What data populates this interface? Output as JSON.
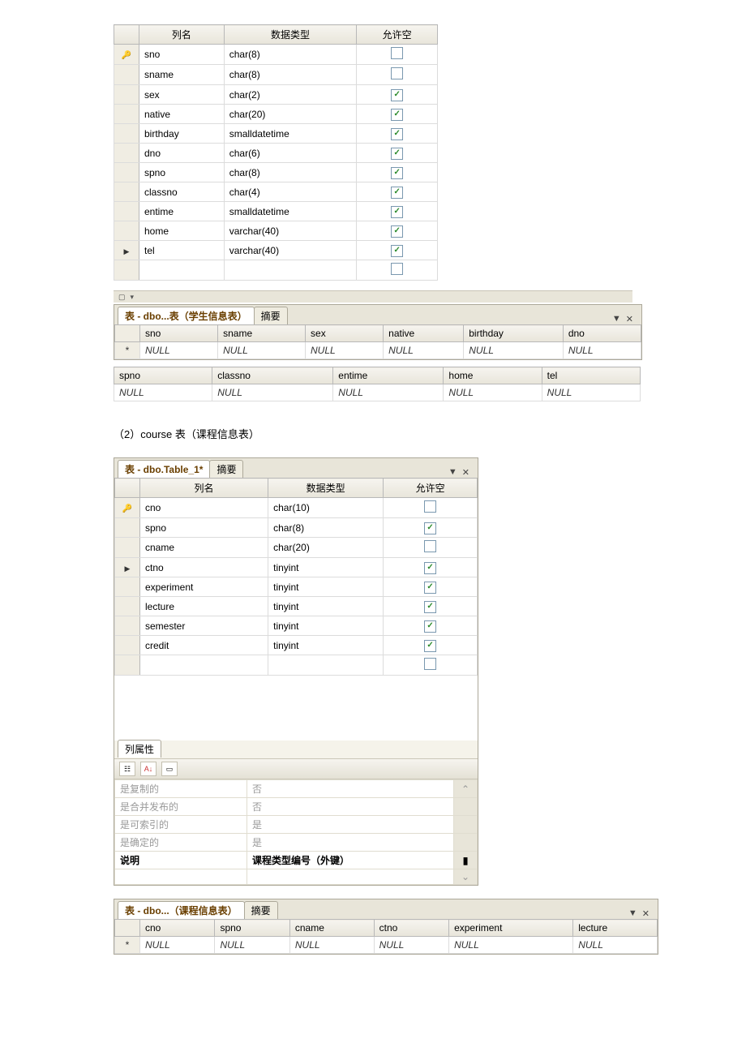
{
  "designer1": {
    "headers": {
      "col_name": "列名",
      "data_type": "数据类型",
      "allow_null": "允许空"
    },
    "rows": [
      {
        "key": true,
        "sel": false,
        "name": "sno",
        "type": "char(8)",
        "null": false
      },
      {
        "key": false,
        "sel": false,
        "name": "sname",
        "type": "char(8)",
        "null": false
      },
      {
        "key": false,
        "sel": false,
        "name": "sex",
        "type": "char(2)",
        "null": true
      },
      {
        "key": false,
        "sel": false,
        "name": "native",
        "type": "char(20)",
        "null": true
      },
      {
        "key": false,
        "sel": false,
        "name": "birthday",
        "type": "smalldatetime",
        "null": true
      },
      {
        "key": false,
        "sel": false,
        "name": "dno",
        "type": "char(6)",
        "null": true
      },
      {
        "key": false,
        "sel": false,
        "name": "spno",
        "type": "char(8)",
        "null": true
      },
      {
        "key": false,
        "sel": false,
        "name": "classno",
        "type": "char(4)",
        "null": true
      },
      {
        "key": false,
        "sel": false,
        "name": "entime",
        "type": "smalldatetime",
        "null": true
      },
      {
        "key": false,
        "sel": false,
        "name": "home",
        "type": "varchar(40)",
        "null": true
      },
      {
        "key": false,
        "sel": true,
        "name": "tel",
        "type": "varchar(40)",
        "null": true,
        "typesel": true
      }
    ]
  },
  "studentDataTab": {
    "tab_active": "表 - dbo...表（学生信息表）",
    "tab_other": "摘要",
    "cols1": [
      "sno",
      "sname",
      "sex",
      "native",
      "birthday",
      "dno"
    ],
    "cols2": [
      "spno",
      "classno",
      "entime",
      "home",
      "tel"
    ],
    "null": "NULL",
    "star": "*"
  },
  "courseLabel": "（2）course 表（课程信息表）",
  "designer2": {
    "tab_active": "表 - dbo.Table_1*",
    "tab_other": "摘要",
    "headers": {
      "col_name": "列名",
      "data_type": "数据类型",
      "allow_null": "允许空"
    },
    "rows": [
      {
        "key": true,
        "sel": false,
        "name": "cno",
        "type": "char(10)",
        "null": false
      },
      {
        "key": false,
        "sel": false,
        "name": "spno",
        "type": "char(8)",
        "null": true
      },
      {
        "key": false,
        "sel": false,
        "name": "cname",
        "type": "char(20)",
        "null": false
      },
      {
        "key": false,
        "sel": true,
        "name": "ctno",
        "type": "tinyint",
        "null": true
      },
      {
        "key": false,
        "sel": false,
        "name": "experiment",
        "type": "tinyint",
        "null": true
      },
      {
        "key": false,
        "sel": false,
        "name": "lecture",
        "type": "tinyint",
        "null": true
      },
      {
        "key": false,
        "sel": false,
        "name": "semester",
        "type": "tinyint",
        "null": true
      },
      {
        "key": false,
        "sel": false,
        "name": "credit",
        "type": "tinyint",
        "null": true
      }
    ]
  },
  "propPanel": {
    "title": "列属性",
    "rows": [
      {
        "k": "是复制的",
        "v": "否"
      },
      {
        "k": "是合并发布的",
        "v": "否"
      },
      {
        "k": "是可索引的",
        "v": "是"
      },
      {
        "k": "是确定的",
        "v": "是"
      }
    ],
    "active": {
      "k": "说明",
      "v": "课程类型编号（外键）"
    }
  },
  "courseDataTab": {
    "tab_active": "表 - dbo...（课程信息表）",
    "tab_other": "摘要",
    "cols": [
      "cno",
      "spno",
      "cname",
      "ctno",
      "experiment",
      "lecture"
    ],
    "null": "NULL",
    "star": "*"
  }
}
